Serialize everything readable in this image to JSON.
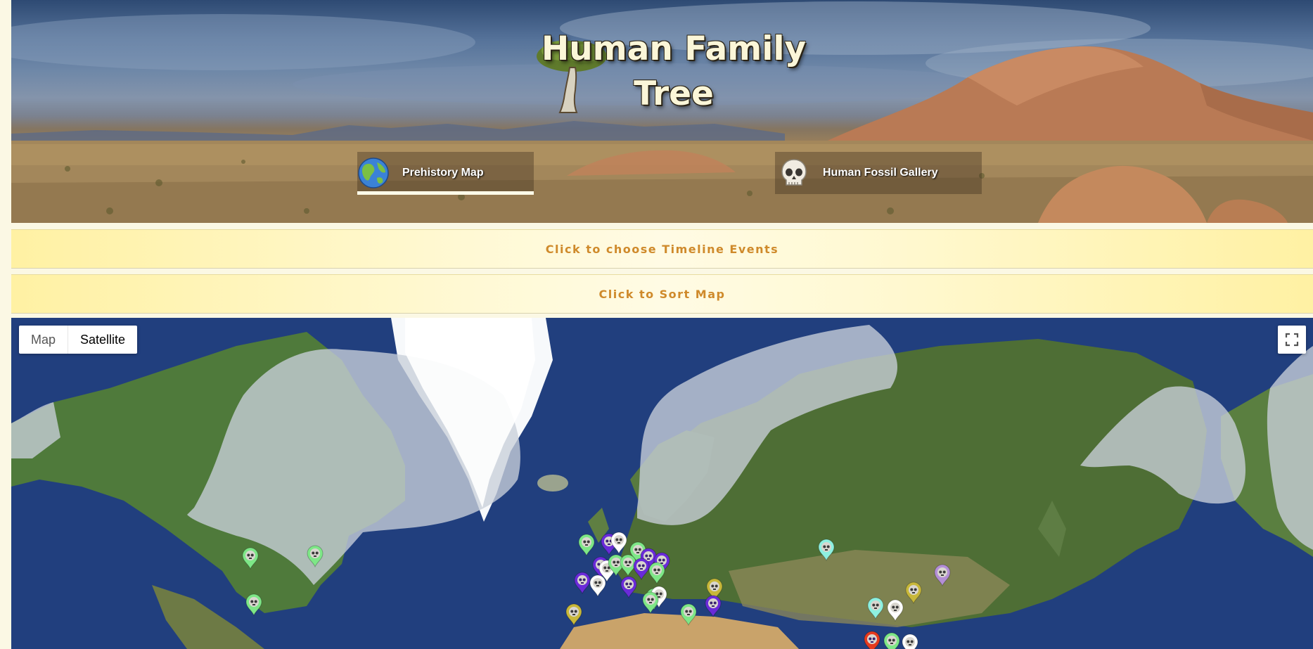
{
  "site": {
    "title": "Human Family Tree"
  },
  "nav": {
    "tabs": [
      {
        "label": "Prehistory Map",
        "icon": "globe-icon",
        "active": true
      },
      {
        "label": "Human Fossil Gallery",
        "icon": "skull-icon",
        "active": false
      }
    ]
  },
  "accordions": {
    "timeline_label": "Click to choose Timeline Events",
    "sort_label": "Click to Sort Map"
  },
  "map": {
    "type_control": {
      "map_label": "Map",
      "satellite_label": "Satellite",
      "selected": "Satellite"
    },
    "fullscreen_icon": "fullscreen-icon",
    "marker_icon": "skull-marker-icon",
    "marker_colors": {
      "light_green": "#7ee787",
      "purple": "#6a2bd9",
      "white": "#ffffff",
      "olive": "#c8b83a",
      "cyan": "#8ef0e0",
      "lavender": "#b48fd6",
      "red": "#e63a1e"
    }
  },
  "colors": {
    "accent_text": "#cf8a2b",
    "bar_bg": "#fff5bf",
    "page_bg": "#fbf8e4"
  }
}
